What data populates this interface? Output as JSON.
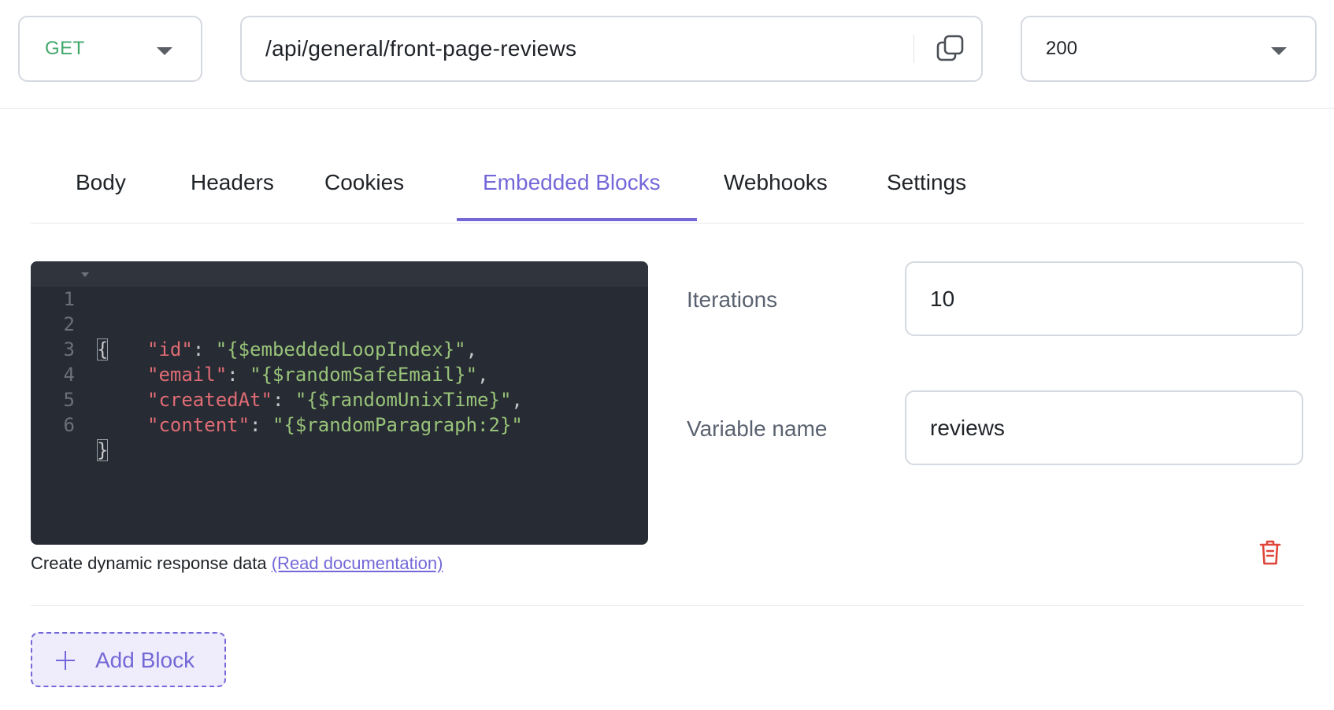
{
  "request": {
    "method": "GET",
    "path": "/api/general/front-page-reviews",
    "status": "200"
  },
  "icons": {
    "method_dropdown": "chevron-down-icon",
    "copy": "copy-icon",
    "status_dropdown": "chevron-down-icon",
    "delete": "trash-icon",
    "add": "plus-icon"
  },
  "colors": {
    "accent": "#7468d8",
    "method_get": "#43a86b",
    "delete": "#e0453a",
    "editor_bg": "#272b33"
  },
  "tabs": [
    {
      "label": "Body",
      "active": false
    },
    {
      "label": "Headers",
      "active": false
    },
    {
      "label": "Cookies",
      "active": false
    },
    {
      "label": "Embedded Blocks",
      "active": true
    },
    {
      "label": "Webhooks",
      "active": false
    },
    {
      "label": "Settings",
      "active": false
    }
  ],
  "editor": {
    "lines": [
      {
        "n": "1",
        "open": "{"
      },
      {
        "n": "2",
        "key": "\"id\"",
        "colon": ": ",
        "value": "\"{$embeddedLoopIndex}\"",
        "trail": ","
      },
      {
        "n": "3",
        "key": "\"email\"",
        "colon": ": ",
        "value": "\"{$randomSafeEmail}\"",
        "trail": ","
      },
      {
        "n": "4",
        "key": "\"createdAt\"",
        "colon": ": ",
        "value": "\"{$randomUnixTime}\"",
        "trail": ","
      },
      {
        "n": "5",
        "key": "\"content\"",
        "colon": ": ",
        "value": "\"{$randomParagraph:2}\"",
        "trail": ""
      },
      {
        "n": "6",
        "close": "}"
      }
    ]
  },
  "helper": {
    "text": "Create dynamic response data ",
    "link": "(Read documentation)"
  },
  "fields": {
    "iterations_label": "Iterations",
    "iterations_value": "10",
    "variable_label": "Variable name",
    "variable_value": "reviews"
  },
  "add_block": {
    "label": "Add Block"
  }
}
